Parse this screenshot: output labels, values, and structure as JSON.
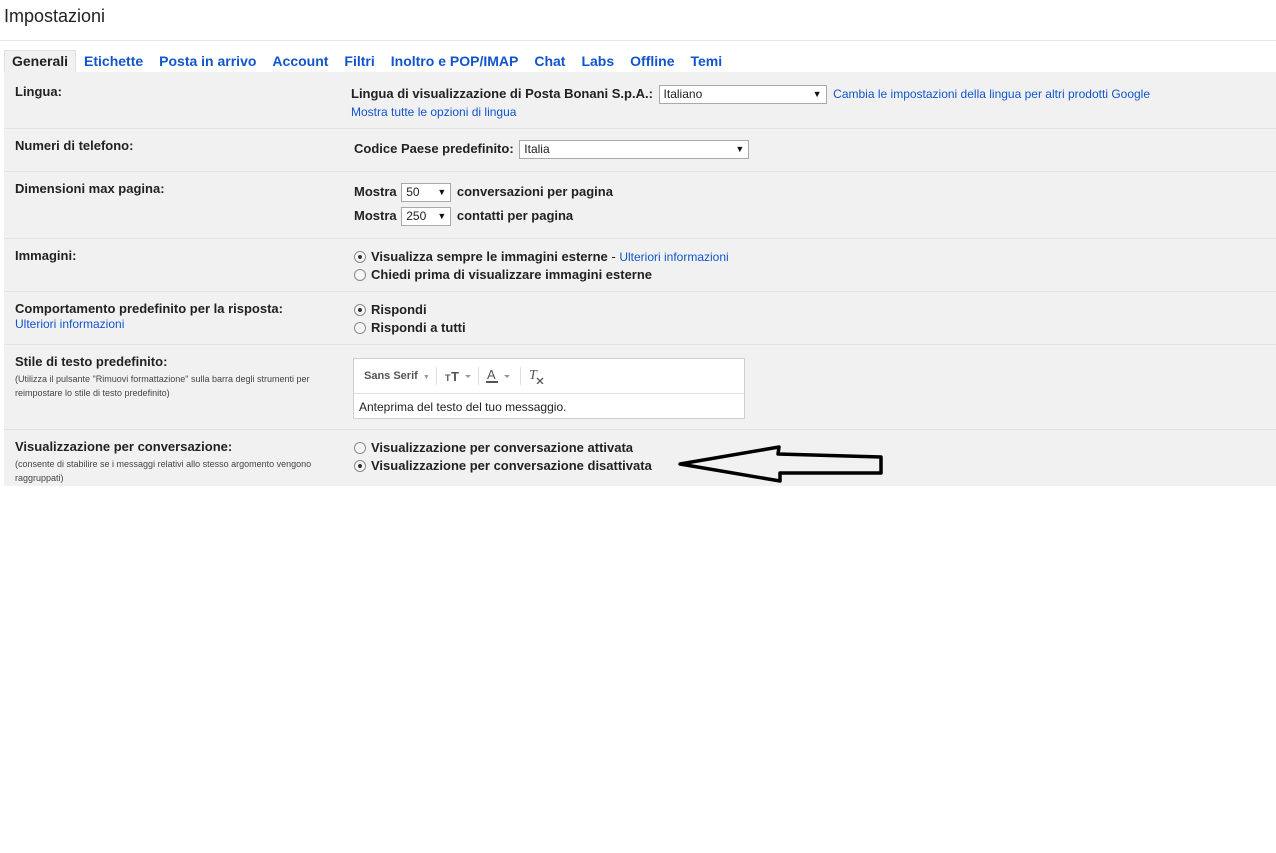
{
  "title": "Impostazioni",
  "tabs": [
    {
      "label": "Generali",
      "active": true
    },
    {
      "label": "Etichette"
    },
    {
      "label": "Posta in arrivo"
    },
    {
      "label": "Account"
    },
    {
      "label": "Filtri"
    },
    {
      "label": "Inoltro e POP/IMAP"
    },
    {
      "label": "Chat"
    },
    {
      "label": "Labs"
    },
    {
      "label": "Offline"
    },
    {
      "label": "Temi"
    }
  ],
  "lingua": {
    "label": "Lingua:",
    "display_label": "Lingua di visualizzazione di Posta Bonani S.p.A.:",
    "selected": "Italiano",
    "change_link": "Cambia le impostazioni della lingua per altri prodotti Google",
    "all_options_link": "Mostra tutte le opzioni di lingua"
  },
  "telefono": {
    "label": "Numeri di telefono:",
    "country_label": "Codice Paese predefinito:",
    "selected": "Italia"
  },
  "dimensioni": {
    "label": "Dimensioni max pagina:",
    "show1": "Mostra",
    "conv_value": "50",
    "conv_suffix": "conversazioni per pagina",
    "show2": "Mostra",
    "contacts_value": "250",
    "contacts_suffix": "contatti per pagina"
  },
  "immagini": {
    "label": "Immagini:",
    "option_always": "Visualizza sempre le immagini esterne",
    "dash": " - ",
    "more_info": "Ulteriori informazioni",
    "option_ask": "Chiedi prima di visualizzare immagini esterne"
  },
  "risposta": {
    "label": "Comportamento predefinito per la risposta:",
    "more_info": "Ulteriori informazioni",
    "option_reply": "Rispondi",
    "option_reply_all": "Rispondi a tutti"
  },
  "stile": {
    "label": "Stile di testo predefinito:",
    "note": "(Utilizza il pulsante \"Rimuovi formattazione\" sulla barra degli strumenti per reimpostare lo stile di testo predefinito)",
    "font_name": "Sans Serif",
    "preview": "Anteprima del testo del tuo messaggio."
  },
  "conversazione": {
    "label": "Visualizzazione per conversazione:",
    "note": "(consente di stabilire se i messaggi relativi allo stesso argomento vengono raggruppati)",
    "option_on": "Visualizzazione per conversazione attivata",
    "option_off": "Visualizzazione per conversazione disattivata"
  },
  "colors": {
    "link": "#1155cc",
    "panel_bg": "#f1f1f1",
    "text": "#222222"
  }
}
